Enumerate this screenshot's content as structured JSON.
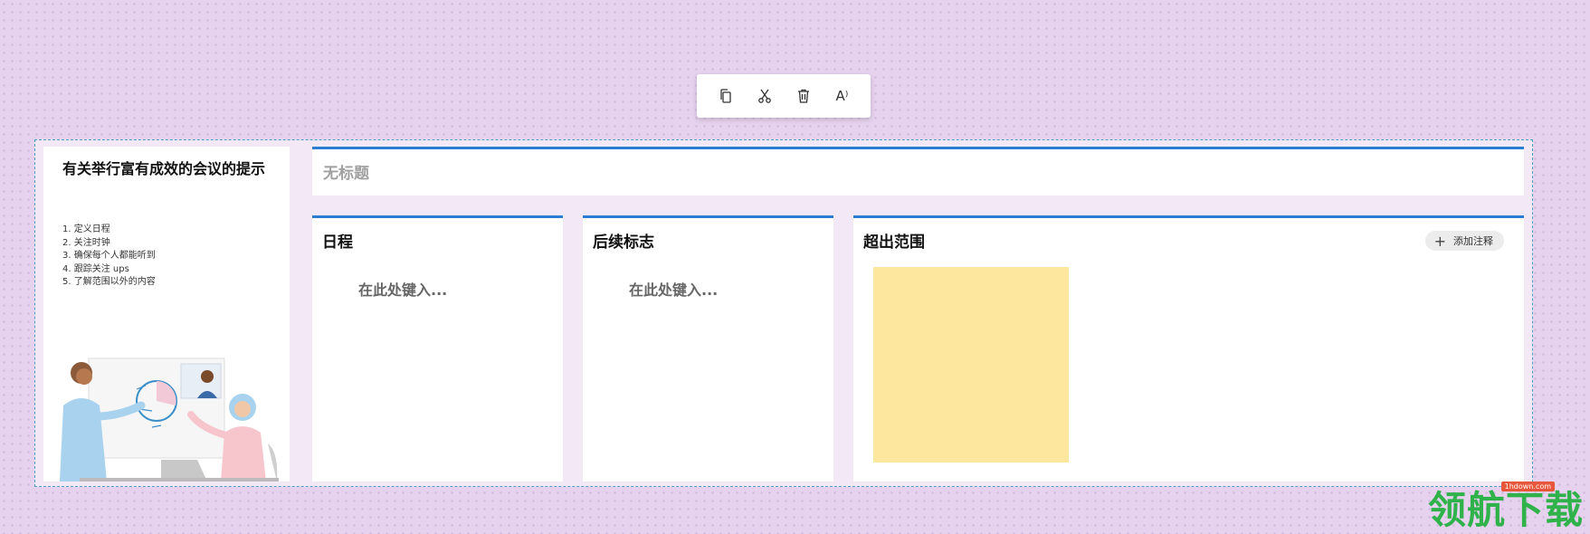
{
  "toolbar": {
    "copy_icon": "copy-icon",
    "cut_icon": "cut-icon",
    "delete_icon": "delete-icon",
    "read_aloud_icon": "read-aloud-icon",
    "read_aloud_glyph": "A⁾"
  },
  "tips": {
    "title": "有关举行富有成效的会议的提示",
    "items": [
      "1. 定义日程",
      "2. 关注时钟",
      "3. 确保每个人都能听到",
      "4. 跟踪关注 ups",
      "5. 了解范围以外的内容"
    ]
  },
  "title_card": {
    "placeholder": "无标题"
  },
  "columns": [
    {
      "title": "日程",
      "placeholder": "在此处键入..."
    },
    {
      "title": "后续标志",
      "placeholder": "在此处键入..."
    },
    {
      "title": "超出范围",
      "add_note_label": "添加注释"
    }
  ],
  "colors": {
    "accent": "#2b7cd3",
    "sticky_note": "#fde79e",
    "frame_border": "#4a9fc6"
  },
  "watermark": {
    "url": "1hdown.com",
    "text": "领航下载"
  }
}
